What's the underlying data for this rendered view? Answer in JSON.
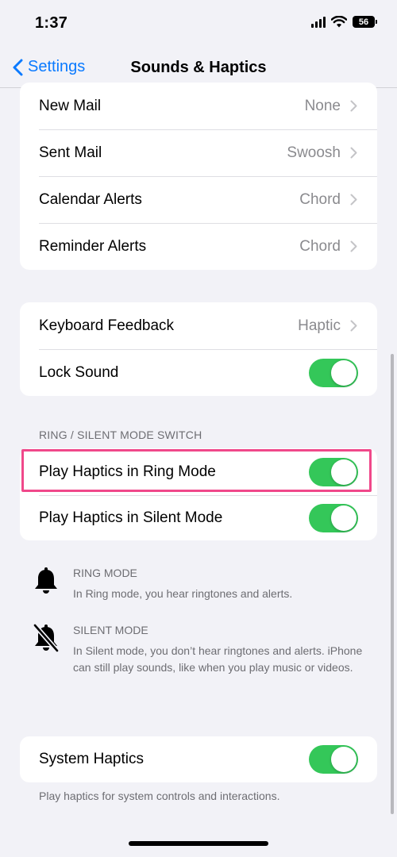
{
  "status_bar": {
    "time": "1:37",
    "battery": "56"
  },
  "nav": {
    "back_label": "Settings",
    "title": "Sounds & Haptics"
  },
  "alerts_group": [
    {
      "label": "New Mail",
      "value": "None"
    },
    {
      "label": "Sent Mail",
      "value": "Swoosh"
    },
    {
      "label": "Calendar Alerts",
      "value": "Chord"
    },
    {
      "label": "Reminder Alerts",
      "value": "Chord"
    }
  ],
  "feedback_group": {
    "keyboard_feedback": {
      "label": "Keyboard Feedback",
      "value": "Haptic"
    },
    "lock_sound": {
      "label": "Lock Sound",
      "on": true
    }
  },
  "ring_silent": {
    "header": "RING / SILENT MODE SWITCH",
    "ring_haptics": {
      "label": "Play Haptics in Ring Mode",
      "on": true
    },
    "silent_haptics": {
      "label": "Play Haptics in Silent Mode",
      "on": true
    }
  },
  "info": {
    "ring": {
      "title": "RING MODE",
      "desc": "In Ring mode, you hear ringtones and alerts.",
      "icon": "bell-icon"
    },
    "silent": {
      "title": "SILENT MODE",
      "desc": "In Silent mode, you don’t hear ringtones and alerts. iPhone can still play sounds, like when you play music or videos.",
      "icon": "bell-slash-icon"
    }
  },
  "system_haptics": {
    "label": "System Haptics",
    "on": true,
    "footnote": "Play haptics for system controls and interactions."
  },
  "colors": {
    "accent": "#0a7aff",
    "toggle_on": "#34c759",
    "highlight": "#f0488a",
    "background": "#f2f2f7"
  }
}
